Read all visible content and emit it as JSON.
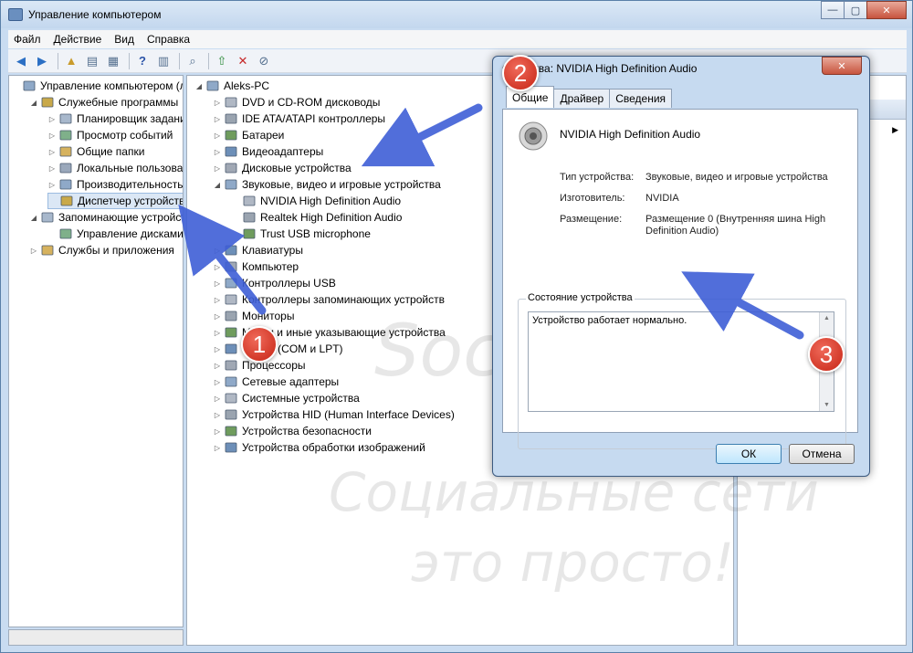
{
  "window": {
    "title": "Управление компьютером",
    "min": "—",
    "max": "▢",
    "close": "✕"
  },
  "menu": [
    "Файл",
    "Действие",
    "Вид",
    "Справка"
  ],
  "left_tree": [
    {
      "label": "Управление компьютером (л",
      "indent": 0,
      "tri": ""
    },
    {
      "label": "Служебные программы",
      "indent": 1,
      "tri": "◢"
    },
    {
      "label": "Планировщик заданий",
      "indent": 2,
      "tri": "▷"
    },
    {
      "label": "Просмотр событий",
      "indent": 2,
      "tri": "▷"
    },
    {
      "label": "Общие папки",
      "indent": 2,
      "tri": "▷"
    },
    {
      "label": "Локальные пользовате",
      "indent": 2,
      "tri": "▷"
    },
    {
      "label": "Производительность",
      "indent": 2,
      "tri": "▷"
    },
    {
      "label": "Диспетчер устройств",
      "indent": 2,
      "tri": "",
      "selected": true
    },
    {
      "label": "Запоминающие устройств",
      "indent": 1,
      "tri": "◢"
    },
    {
      "label": "Управление дисками",
      "indent": 2,
      "tri": ""
    },
    {
      "label": "Службы и приложения",
      "indent": 1,
      "tri": "▷"
    }
  ],
  "device_tree": [
    {
      "label": "Aleks-PC",
      "indent": 0,
      "tri": "◢"
    },
    {
      "label": "DVD и CD-ROM дисководы",
      "indent": 1,
      "tri": "▷"
    },
    {
      "label": "IDE ATA/ATAPI контроллеры",
      "indent": 1,
      "tri": "▷"
    },
    {
      "label": "Батареи",
      "indent": 1,
      "tri": "▷"
    },
    {
      "label": "Видеоадаптеры",
      "indent": 1,
      "tri": "▷"
    },
    {
      "label": "Дисковые устройства",
      "indent": 1,
      "tri": "▷"
    },
    {
      "label": "Звуковые, видео и игровые устройства",
      "indent": 1,
      "tri": "◢"
    },
    {
      "label": "NVIDIA High Definition Audio",
      "indent": 2,
      "tri": ""
    },
    {
      "label": "Realtek High Definition Audio",
      "indent": 2,
      "tri": ""
    },
    {
      "label": "Trust USB microphone",
      "indent": 2,
      "tri": ""
    },
    {
      "label": "Клавиатуры",
      "indent": 1,
      "tri": "▷"
    },
    {
      "label": "Компьютер",
      "indent": 1,
      "tri": "▷"
    },
    {
      "label": "Контроллеры USB",
      "indent": 1,
      "tri": "▷"
    },
    {
      "label": "Контроллеры запоминающих устройств",
      "indent": 1,
      "tri": "▷"
    },
    {
      "label": "Мониторы",
      "indent": 1,
      "tri": "▷"
    },
    {
      "label": "Мыши и иные указывающие устройства",
      "indent": 1,
      "tri": "▷"
    },
    {
      "label": "Порты (COM и LPT)",
      "indent": 1,
      "tri": "▷"
    },
    {
      "label": "Процессоры",
      "indent": 1,
      "tri": "▷"
    },
    {
      "label": "Сетевые адаптеры",
      "indent": 1,
      "tri": "▷"
    },
    {
      "label": "Системные устройства",
      "indent": 1,
      "tri": "▷"
    },
    {
      "label": "Устройства HID (Human Interface Devices)",
      "indent": 1,
      "tri": "▷"
    },
    {
      "label": "Устройства безопасности",
      "indent": 1,
      "tri": "▷"
    },
    {
      "label": "Устройства обработки изображений",
      "indent": 1,
      "tri": "▷"
    }
  ],
  "dialog": {
    "title": "Свойства: NVIDIA High Definition Audio",
    "close": "✕",
    "tabs": [
      "Общие",
      "Драйвер",
      "Сведения"
    ],
    "device_name": "NVIDIA High Definition Audio",
    "props": [
      {
        "label": "Тип устройства:",
        "value": "Звуковые, видео и игровые устройства"
      },
      {
        "label": "Изготовитель:",
        "value": "NVIDIA"
      },
      {
        "label": "Размещение:",
        "value": "Размещение 0 (Внутренняя шина High Definition Audio)"
      }
    ],
    "status_group": "Состояние устройства",
    "status_text": "Устройство работает нормально.",
    "ok": "ОК",
    "cancel": "Отмена"
  },
  "badges": [
    "1",
    "2",
    "3"
  ],
  "watermark": [
    "Soc-FAQ.ru",
    "Социальные сети",
    "это просто!"
  ],
  "colors": {
    "arrow": "#3f5fd6",
    "badge": "#d93a28",
    "selection": "#dbe7f5"
  }
}
